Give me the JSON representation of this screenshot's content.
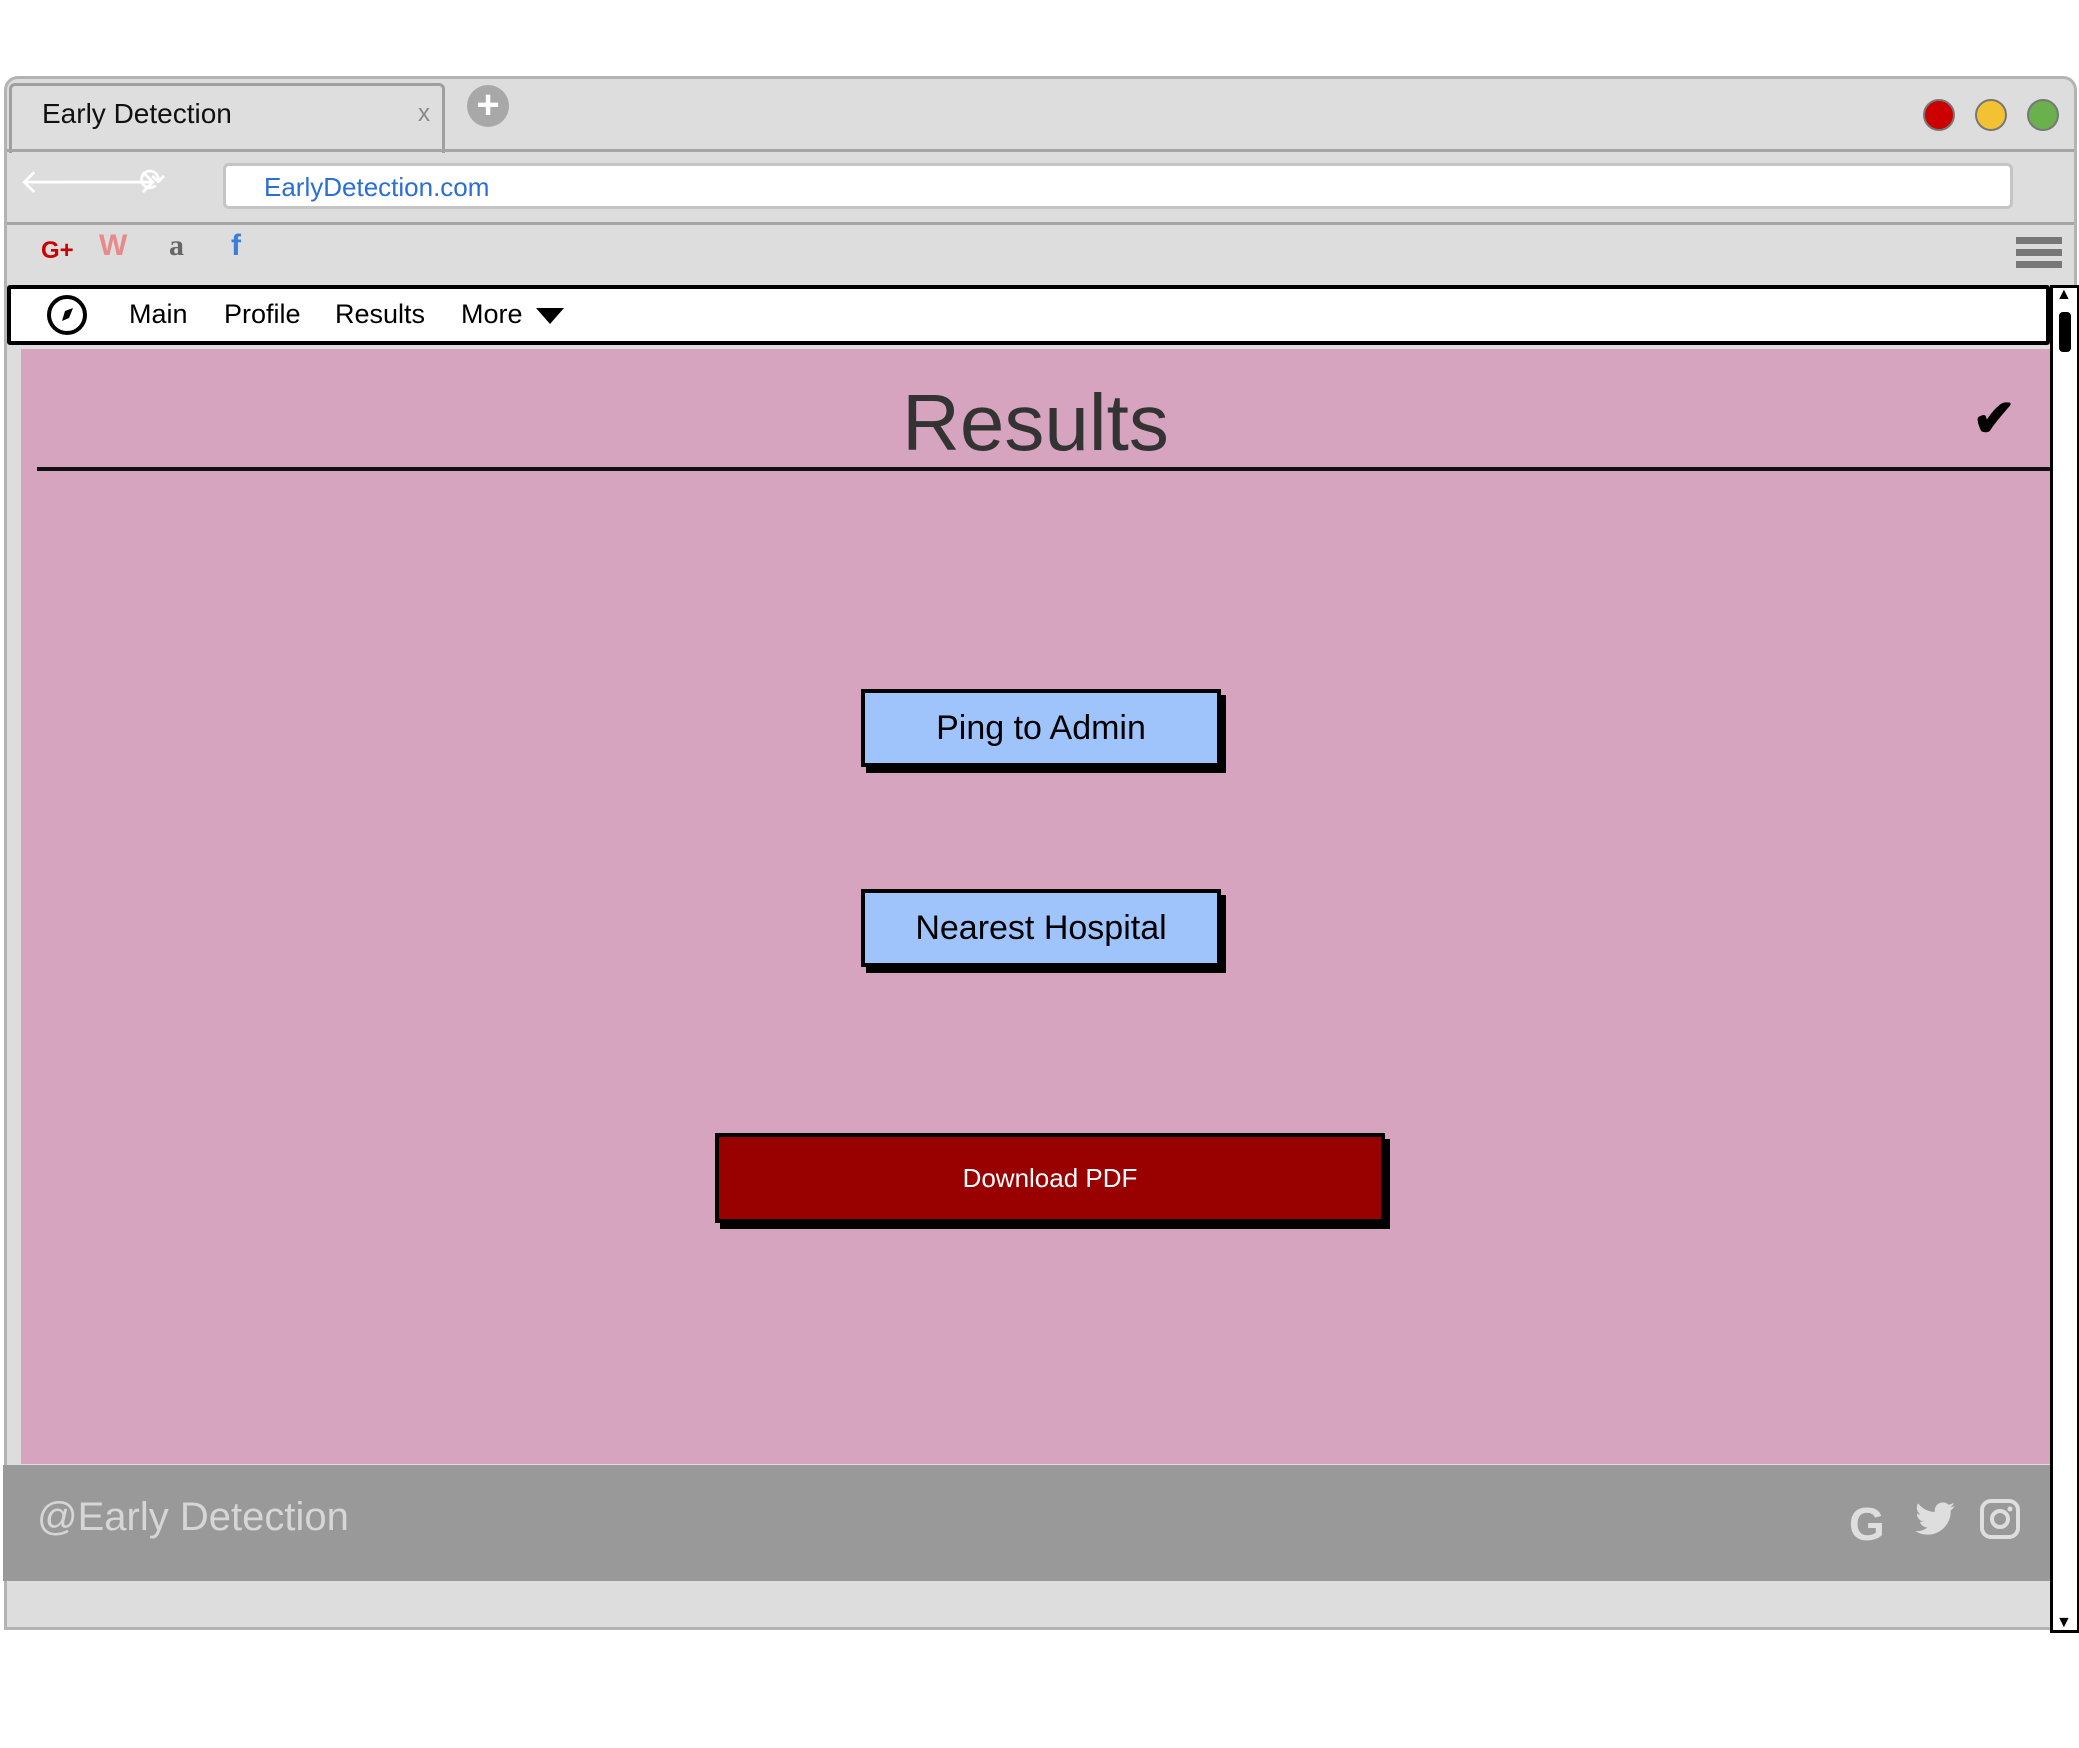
{
  "browser": {
    "tab_title": "Early Detection",
    "tab_close": "x",
    "new_tab": "+",
    "url": "EarlyDetection.com",
    "bookmarks": [
      {
        "icon": "google-plus-icon",
        "label": "G+",
        "color": "#cc0000"
      },
      {
        "icon": "office-icon",
        "label": "W",
        "color": "#e88a8a"
      },
      {
        "icon": "amazon-icon",
        "label": "a",
        "color": "#666666"
      },
      {
        "icon": "facebook-icon",
        "label": "f",
        "color": "#3b7ddd"
      }
    ],
    "traffic_lights": {
      "close": "#cc0000",
      "minimize": "#f2c232",
      "maximize": "#6ab04c"
    }
  },
  "navbar": {
    "links": [
      "Main",
      "Profile",
      "Results",
      "More"
    ]
  },
  "page": {
    "title": "Results",
    "check_icon": "✔",
    "buttons": {
      "ping": "Ping to Admin",
      "hospital": "Nearest Hospital",
      "download": "Download PDF"
    },
    "colors": {
      "background": "#d6a4be",
      "primary_button": "#9fc4fb",
      "download_button": "#990000",
      "footer": "#999999"
    }
  },
  "footer": {
    "text": "@Early Detection",
    "icons": [
      "google-icon",
      "twitter-icon",
      "instagram-icon"
    ]
  }
}
